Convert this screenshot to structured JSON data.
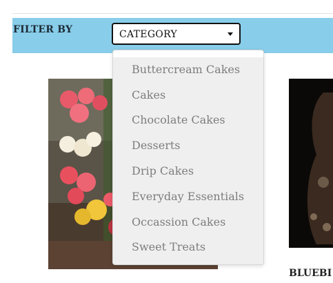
{
  "filter": {
    "label": "FILTER BY",
    "selected": "CATEGORY",
    "options": [
      "Buttercream Cakes",
      "Cakes",
      "Chocolate Cakes",
      "Desserts",
      "Drip Cakes",
      "Everyday Essentials",
      "Occassion Cakes",
      "Sweet Treats"
    ]
  },
  "products": {
    "right_title": "BLUEBI"
  },
  "colors": {
    "filter_bar": "#88cde9",
    "dropdown_bg": "#efefef",
    "option_text": "#7d7d7d"
  }
}
